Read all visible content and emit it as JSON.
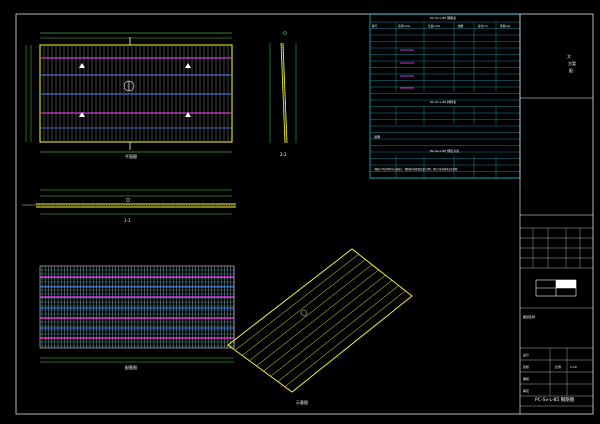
{
  "colors": {
    "background": "#000000",
    "frame": "#ffffff",
    "rebar_white": "#ffffff",
    "rebar_cyan": "#22e6ff",
    "rebar_magenta": "#ff3dff",
    "rebar_blue": "#4a7dff",
    "slab_outline": "#ffff33",
    "table_lines": "#22e6ff",
    "dimension": "#66ff66",
    "drawing_number": "#ffff33"
  },
  "views": {
    "plan_label": "平面图",
    "section_1_label": "1-1",
    "section_2_label": "2-2",
    "rebar_plan_label": "配筋图",
    "iso_label": "示意图"
  },
  "tables": {
    "header_cols": [
      "编号",
      "直径(mm)",
      "长度(mm)",
      "根数",
      "总长(m)",
      "重量(kg)"
    ],
    "rebar_title": "PC-Sv-L-85 钢筋表",
    "materials_title": "PC-Sv-L-85 材料表",
    "prestress_title": "PC-Sv-L-85 预应力表",
    "notes_title": "说明",
    "notes": "本图尺寸除注明外均以毫米计，钢筋保护层厚度见设计说明，预应力张拉要求见总说明。"
  },
  "title_block": {
    "top_text": [
      "大",
      "方案",
      "配"
    ],
    "block_label": "图纸名称",
    "rows": [
      "设计",
      "复核",
      "审核",
      "审定"
    ],
    "scale_label": "比例",
    "scale_value": "1:20",
    "drawing_number": "PC-Sv-L-85 钢筋图"
  },
  "icons": [
    "section-marker-icon",
    "north-arrow-icon",
    "triangle-support-icon"
  ]
}
